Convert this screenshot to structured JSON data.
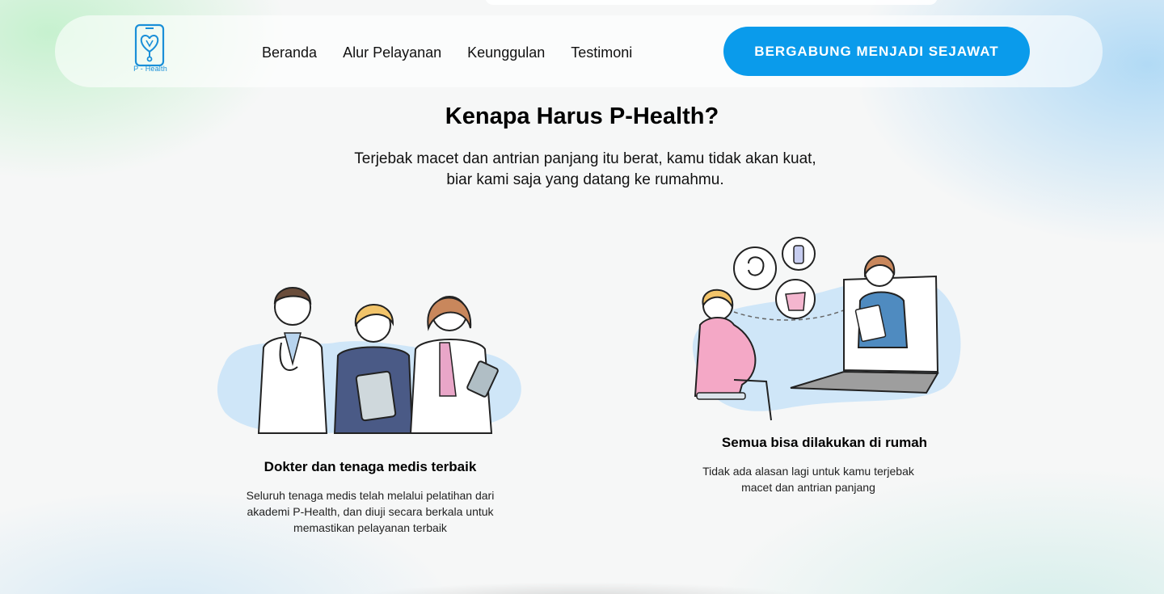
{
  "brand": {
    "logo_text": "P - Health",
    "accent": "#0a9beb",
    "icon": "heart-stethoscope-phone-icon"
  },
  "nav": {
    "items": [
      {
        "label": "Beranda"
      },
      {
        "label": "Alur Pelayanan"
      },
      {
        "label": "Keunggulan"
      },
      {
        "label": "Testimoni"
      }
    ],
    "cta_label": "BERGABUNG MENJADI SEJAWAT"
  },
  "section": {
    "title": "Kenapa Harus P-Health?",
    "subtitle_line1": "Terjebak macet dan antrian panjang itu berat, kamu tidak akan kuat,",
    "subtitle_line2": "biar kami saja yang datang ke rumahmu."
  },
  "features": [
    {
      "illustration": "medical-team-illustration",
      "title": "Dokter dan tenaga medis terbaik",
      "desc_line1": "Seluruh tenaga medis telah melalui pelatihan dari",
      "desc_line2": "akademi P-Health, dan diuji secara berkala untuk",
      "desc_line3": "memastikan pelayanan terbaik"
    },
    {
      "illustration": "telemedicine-pregnancy-illustration",
      "title": "Semua bisa dilakukan di rumah",
      "desc_line1": "Tidak ada alasan lagi untuk kamu terjebak",
      "desc_line2": "macet dan antrian panjang"
    }
  ]
}
